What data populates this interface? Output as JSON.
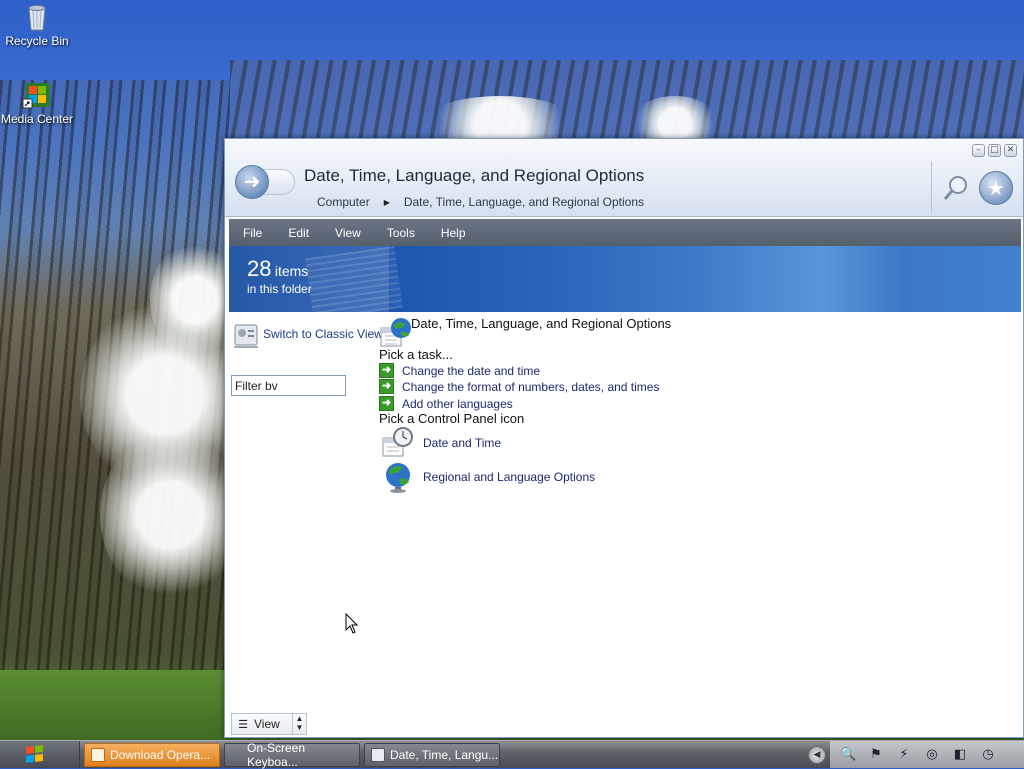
{
  "desktop": {
    "icons": [
      {
        "label": "Recycle Bin",
        "icon": "recycle-bin-icon"
      },
      {
        "label": "Media Center",
        "icon": "media-center-icon"
      }
    ]
  },
  "window": {
    "title": "Date, Time, Language, and Regional Options",
    "breadcrumb": [
      "Computer",
      "Date, Time, Language, and Regional Options"
    ],
    "controls": {
      "minimize": "▭",
      "maximize": "▭",
      "close": "✕"
    },
    "menu": [
      "File",
      "Edit",
      "View",
      "Tools",
      "Help"
    ],
    "banner": {
      "count": "28",
      "unit": "items",
      "subtitle": "in this folder"
    },
    "sidebar": {
      "classic_view": "Switch to Classic View",
      "filter_value": "Filter bv"
    },
    "category_title": "Date, Time, Language, and Regional Options",
    "pick_task_label": "Pick a task...",
    "tasks": [
      "Change the date and time",
      "Change the format of numbers, dates, and times",
      "Add other languages"
    ],
    "pick_icon_label": "Pick a Control Panel icon",
    "cp_items": [
      {
        "label": "Date and Time",
        "icon": "date-time-icon"
      },
      {
        "label": "Regional and Language Options",
        "icon": "globe-icon"
      }
    ],
    "view_button": "View"
  },
  "taskbar": {
    "buttons": [
      {
        "label": "Download Opera...",
        "style": "orange"
      },
      {
        "label": "On-Screen Keyboa...",
        "style": "gray"
      },
      {
        "label": "Date, Time, Langu...",
        "style": "gray"
      }
    ],
    "colors": {
      "active": "#e0801c",
      "accent": "#1f56ad"
    }
  }
}
